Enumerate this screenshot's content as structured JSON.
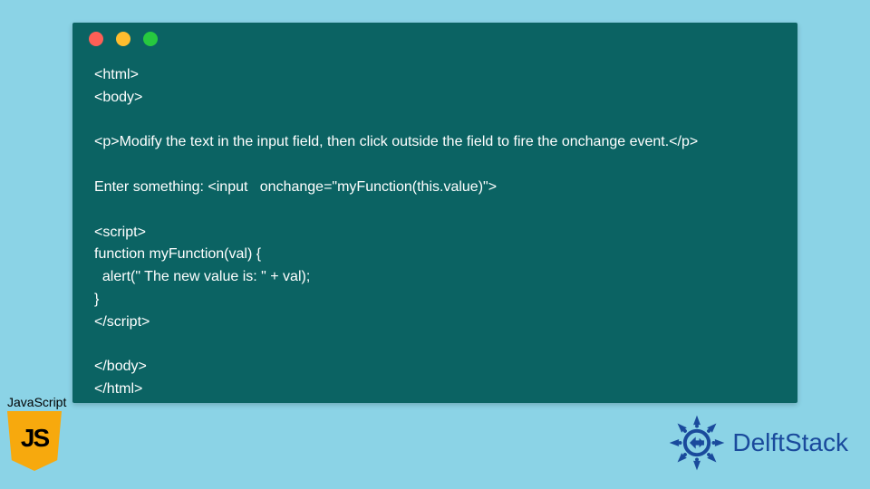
{
  "code_window": {
    "dots": [
      "red",
      "yellow",
      "green"
    ],
    "lines": [
      "<html>",
      "<body>",
      "",
      "<p>Modify the text in the input field, then click outside the field to fire the onchange event.</p>",
      "",
      "Enter something: <input   onchange=\"myFunction(this.value)\">",
      "",
      "<script>",
      "function myFunction(val) {",
      "  alert(\" The new value is: \" + val);",
      "}",
      "</script>",
      "",
      "</body>",
      "</html>"
    ]
  },
  "js_badge": {
    "label": "JavaScript",
    "shield_text": "JS"
  },
  "brand": {
    "name": "DelftStack"
  },
  "colors": {
    "page_bg": "#8bd3e6",
    "code_bg": "#0b6363",
    "code_fg": "#ffffff",
    "dot_red": "#ff5f56",
    "dot_yellow": "#ffbd2e",
    "dot_green": "#27c93f",
    "js_shield": "#f7a90d",
    "brand_blue": "#1a4a9c"
  }
}
